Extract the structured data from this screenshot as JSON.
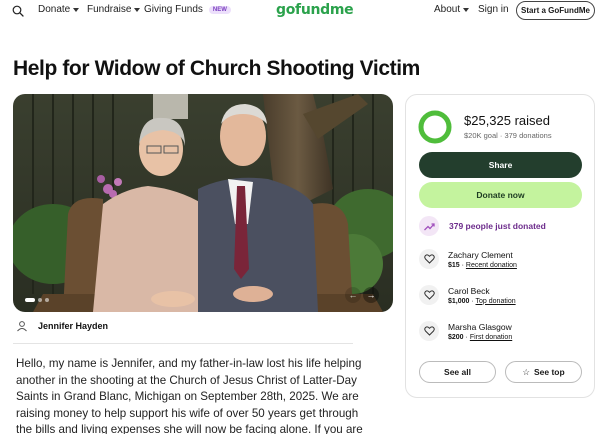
{
  "nav": {
    "donate": "Donate",
    "fundraise": "Fundraise",
    "giving_funds": "Giving Funds",
    "new_badge": "NEW",
    "logo": "gofundme",
    "about": "About",
    "sign_in": "Sign in",
    "start_button": "Start a GoFundMe"
  },
  "campaign": {
    "title": "Help for Widow of Church Shooting Victim",
    "organizer": "Jennifer Hayden",
    "story": "Hello, my name is Jennifer, and my father-in-law lost his life helping another in the shooting at the Church of Jesus Christ of Latter-Day Saints in Grand Blanc, Michigan on September 28th, 2025. We are raising money to help support his wife of over 50 years get through the bills and living expenses she will now be facing alone. If you are"
  },
  "donation_card": {
    "raised": "$25,325 raised",
    "goal": "$20K goal",
    "donations": "379 donations",
    "progress_percent": 100,
    "share_button": "Share",
    "donate_button": "Donate now",
    "trending": "379 people just donated",
    "donors": [
      {
        "name": "Zachary Clement",
        "amount": "$15",
        "label": "Recent donation"
      },
      {
        "name": "Carol Beck",
        "amount": "$1,000",
        "label": "Top donation"
      },
      {
        "name": "Marsha Glasgow",
        "amount": "$200",
        "label": "First donation"
      }
    ],
    "see_all": "See all",
    "see_top": "See top"
  },
  "colors": {
    "brand_green": "#2ba24c",
    "share_bg": "#233e2d",
    "donate_bg": "#c4f39e",
    "trend_purple": "#6d2c8c"
  }
}
